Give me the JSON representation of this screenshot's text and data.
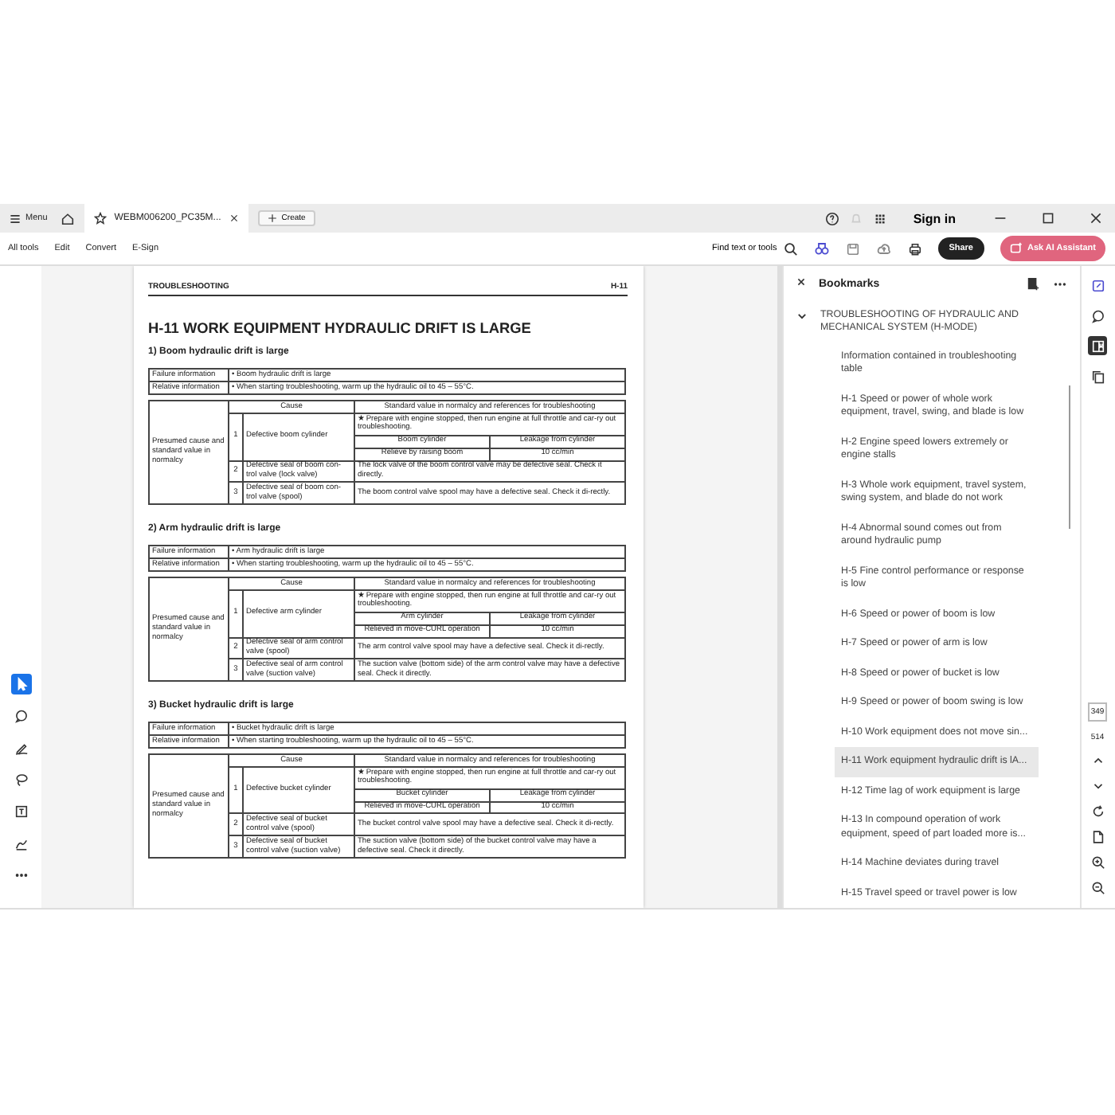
{
  "tab_bar": {
    "menu": "Menu",
    "tabs": [
      {
        "title": "WEBM006200_PC35M...",
        "selected": true
      }
    ],
    "create": "Create",
    "sign_in": "Sign in"
  },
  "toolbar": {
    "items": [
      "All tools",
      "Edit",
      "Convert",
      "E-Sign"
    ],
    "search": "Find text or tools",
    "share": "Share",
    "ai": "Ask AI Assistant"
  },
  "tool_rail": [
    {
      "kind": "select",
      "selected": true
    },
    {
      "kind": "comment",
      "selected": false
    },
    {
      "kind": "pen",
      "selected": false
    },
    {
      "kind": "lasso",
      "selected": false
    },
    {
      "kind": "text",
      "selected": false
    },
    {
      "kind": "sign",
      "selected": false
    },
    {
      "kind": "more",
      "selected": false
    }
  ],
  "document": {
    "header_left": "TROUBLESHOOTING",
    "header_right": "H-11",
    "title": "H-11  WORK EQUIPMENT HYDRAULIC DRIFT IS LARGE",
    "sections": [
      {
        "heading": "1)  Boom hydraulic drift is large",
        "info": [
          {
            "label": "Failure information",
            "text": "•  Boom hydraulic drift is large"
          },
          {
            "label": "Relative information",
            "text": "•  When starting troubleshooting, warm up the hydraulic oil to 45 – 55°C."
          }
        ],
        "cause_header": "Cause",
        "standard_header": "Standard value in normalcy and references for troubleshooting",
        "group": "Presumed cause and standard value in normalcy",
        "causes": [
          {
            "no": "1",
            "cause": "Defective boom cylinder",
            "kind": "measure",
            "note": "★ Prepare with engine stopped, then run engine at full throttle and car-ry out troubleshooting.",
            "measure": [
              [
                "Boom cylinder",
                "Leakage from cylinder"
              ],
              [
                "Relieve by raising boom",
                "10 cc/min"
              ]
            ]
          },
          {
            "no": "2",
            "cause": "Defective seal of boom con-trol valve (lock valve)",
            "kind": "text",
            "text": "The lock valve of the boom control valve may be defective seal.  Check it directly."
          },
          {
            "no": "3",
            "cause": "Defective seal of boom con-trol valve (spool)",
            "kind": "text",
            "text": "The boom control valve spool may have a defective seal.  Check it di-rectly."
          }
        ]
      },
      {
        "heading": "2)  Arm hydraulic drift is large",
        "info": [
          {
            "label": "Failure information",
            "text": "•  Arm hydraulic drift is large"
          },
          {
            "label": "Relative information",
            "text": "•  When starting troubleshooting, warm up the hydraulic oil to 45 – 55°C."
          }
        ],
        "cause_header": "Cause",
        "standard_header": "Standard value in normalcy and references for troubleshooting",
        "group": "Presumed cause and standard value in normalcy",
        "causes": [
          {
            "no": "1",
            "cause": "Defective arm cylinder",
            "kind": "measure",
            "note": "★ Prepare with engine stopped, then run engine at full throttle and car-ry out troubleshooting.",
            "measure": [
              [
                "Arm cylinder",
                "Leakage from cylinder"
              ],
              [
                "Relieved in move-CURL operation",
                "10 cc/min"
              ]
            ]
          },
          {
            "no": "2",
            "cause": "Defective seal of arm control valve (spool)",
            "kind": "text",
            "text": "The arm control valve spool may have a defective seal.  Check it di-rectly."
          },
          {
            "no": "3",
            "cause": "Defective seal of arm control valve (suction valve)",
            "kind": "text",
            "text": "The suction valve (bottom side) of the arm control valve may have a defective seal.  Check it directly."
          }
        ]
      },
      {
        "heading": "3)  Bucket hydraulic drift is large",
        "info": [
          {
            "label": "Failure information",
            "text": "•  Bucket hydraulic drift is large"
          },
          {
            "label": "Relative information",
            "text": "•  When starting troubleshooting, warm up the hydraulic oil to 45 – 55°C."
          }
        ],
        "cause_header": "Cause",
        "standard_header": "Standard value in normalcy and references for troubleshooting",
        "group": "Presumed cause and standard value in normalcy",
        "causes": [
          {
            "no": "1",
            "cause": "Defective bucket cylinder",
            "kind": "measure",
            "note": "★ Prepare with engine stopped, then run engine at full throttle and car-ry out troubleshooting.",
            "measure": [
              [
                "Bucket  cylinder",
                "Leakage from cylinder"
              ],
              [
                "Relieved in move-CURL operation",
                "10 cc/min"
              ]
            ]
          },
          {
            "no": "2",
            "cause": "Defective seal of bucket control valve (spool)",
            "kind": "text",
            "text": "The bucket control valve spool may have a defective seal.  Check it di-rectly."
          },
          {
            "no": "3",
            "cause": "Defective seal of bucket control valve (suction valve)",
            "kind": "text",
            "text": "The suction valve (bottom side) of the bucket control valve may have a defective seal.  Check it directly."
          }
        ]
      }
    ]
  },
  "bookmarks": {
    "title": "Bookmarks",
    "items": [
      {
        "label": "TROUBLESHOOTING OF HYDRAULIC AND MECHANICAL SYSTEM (H-MODE)",
        "expanded": true,
        "selected": false,
        "children": [
          {
            "label": "Information contained in troubleshooting table",
            "selected": false
          },
          {
            "label": "H-1 Speed or power of whole work equipment, travel, swing, and blade is low",
            "selected": false
          },
          {
            "label": "H-2 Engine speed lowers extremely or engine stalls",
            "selected": false
          },
          {
            "label": "H-3 Whole work equipment, travel system, swing system, and blade do not work",
            "selected": false
          },
          {
            "label": "H-4 Abnormal sound comes out from around hydraulic pump",
            "selected": false
          },
          {
            "label": "H-5 Fine control performance or response is low",
            "selected": false
          },
          {
            "label": "H-6 Speed or power of boom is low",
            "selected": false
          },
          {
            "label": "H-7 Speed or power of arm is low",
            "selected": false
          },
          {
            "label": "H-8 Speed or power of bucket is low",
            "selected": false
          },
          {
            "label": "H-9 Speed or power of boom swing is low",
            "selected": false
          },
          {
            "label": "H-10 Work equipment does not move sin...",
            "selected": false
          },
          {
            "label": "H-11 Work equipment hydraulic drift is lA...",
            "selected": true
          },
          {
            "label": "H-12 Time lag of work equipment is large",
            "selected": false
          },
          {
            "label": "H-13 In compound operation of work equipment, speed of part loaded more is...",
            "selected": false
          },
          {
            "label": "H-14 Machine deviates during travel",
            "selected": false
          },
          {
            "label": "H-15 Travel speed or travel power is low",
            "selected": false
          }
        ]
      }
    ]
  },
  "right_rail": {
    "panels": [
      {
        "kind": "ai",
        "selected": false
      },
      {
        "kind": "comment",
        "selected": false
      },
      {
        "kind": "bookmark",
        "selected": true
      },
      {
        "kind": "pages",
        "selected": false
      }
    ],
    "page_current": "349",
    "page_total": "514",
    "actions": [
      {
        "kind": "up"
      },
      {
        "kind": "down"
      },
      {
        "kind": "rotate"
      },
      {
        "kind": "save"
      },
      {
        "kind": "zoom-in"
      },
      {
        "kind": "zoom-out"
      }
    ]
  }
}
